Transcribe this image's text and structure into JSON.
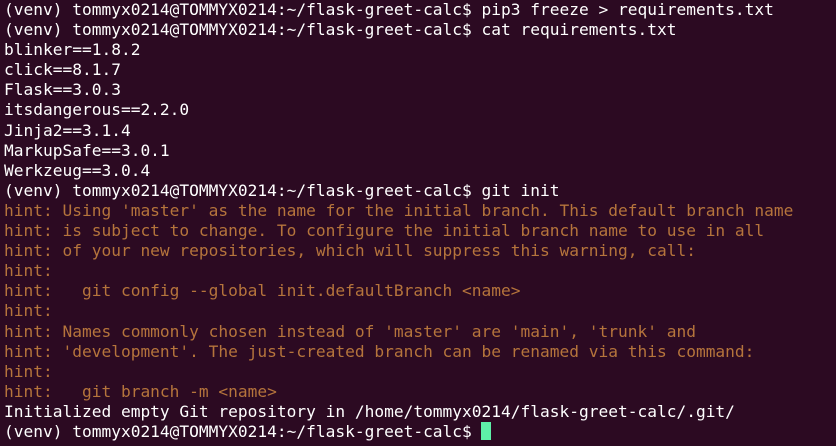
{
  "terminal": {
    "colors": {
      "background": "#2c0a22",
      "text": "#ffffff",
      "hint": "#b5743c",
      "cursor": "#5ef0a8"
    },
    "lines": [
      {
        "type": "command",
        "text": "(venv) tommyx0214@TOMMYX0214:~/flask-greet-calc$ pip3 freeze > requirements.txt"
      },
      {
        "type": "command",
        "text": "(venv) tommyx0214@TOMMYX0214:~/flask-greet-calc$ cat requirements.txt"
      },
      {
        "type": "output",
        "text": "blinker==1.8.2"
      },
      {
        "type": "output",
        "text": "click==8.1.7"
      },
      {
        "type": "output",
        "text": "Flask==3.0.3"
      },
      {
        "type": "output",
        "text": "itsdangerous==2.2.0"
      },
      {
        "type": "output",
        "text": "Jinja2==3.1.4"
      },
      {
        "type": "output",
        "text": "MarkupSafe==3.0.1"
      },
      {
        "type": "output",
        "text": "Werkzeug==3.0.4"
      },
      {
        "type": "command",
        "text": "(venv) tommyx0214@TOMMYX0214:~/flask-greet-calc$ git init"
      },
      {
        "type": "hint",
        "text": "hint: Using 'master' as the name for the initial branch. This default branch name"
      },
      {
        "type": "hint",
        "text": "hint: is subject to change. To configure the initial branch name to use in all"
      },
      {
        "type": "hint",
        "text": "hint: of your new repositories, which will suppress this warning, call:"
      },
      {
        "type": "hint",
        "text": "hint:"
      },
      {
        "type": "hint",
        "text": "hint:   git config --global init.defaultBranch <name>"
      },
      {
        "type": "hint",
        "text": "hint:"
      },
      {
        "type": "hint",
        "text": "hint: Names commonly chosen instead of 'master' are 'main', 'trunk' and"
      },
      {
        "type": "hint",
        "text": "hint: 'development'. The just-created branch can be renamed via this command:"
      },
      {
        "type": "hint",
        "text": "hint:"
      },
      {
        "type": "hint",
        "text": "hint:   git branch -m <name>"
      },
      {
        "type": "output",
        "text": "Initialized empty Git repository in /home/tommyx0214/flask-greet-calc/.git/"
      }
    ],
    "prompt": "(venv) tommyx0214@TOMMYX0214:~/flask-greet-calc$"
  }
}
